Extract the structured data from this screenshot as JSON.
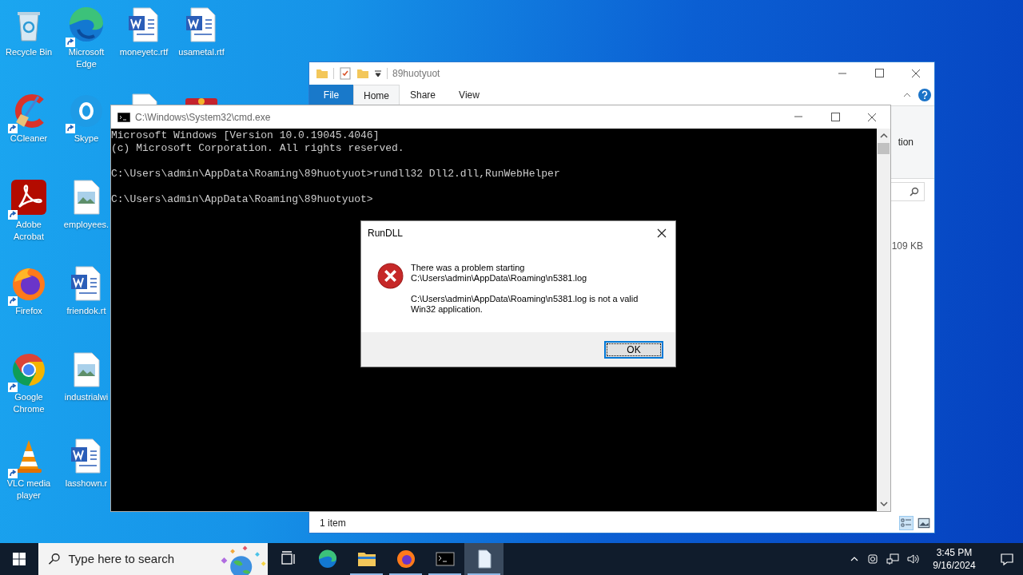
{
  "desktop_columns": [
    [
      {
        "label": "Recycle Bin",
        "kind": "recycle",
        "shortcut": false
      },
      {
        "label": "CCleaner",
        "kind": "broom",
        "shortcut": true
      },
      {
        "label": "Adobe Acrobat",
        "kind": "pdf",
        "shortcut": true
      },
      {
        "label": "Firefox",
        "kind": "firefox",
        "shortcut": true
      },
      {
        "label": "Google Chrome",
        "kind": "chrome",
        "shortcut": true
      },
      {
        "label": "VLC media player",
        "kind": "cone",
        "shortcut": true
      }
    ],
    [
      {
        "label": "Microsoft Edge",
        "kind": "edge",
        "shortcut": true
      },
      {
        "label": "Skype",
        "kind": "skype",
        "shortcut": true
      },
      {
        "label": "employees.",
        "kind": "image",
        "shortcut": false
      },
      {
        "label": "friendok.rt",
        "kind": "word",
        "shortcut": false
      },
      {
        "label": "industrialwi",
        "kind": "image",
        "shortcut": false
      },
      {
        "label": "lasshown.r",
        "kind": "word",
        "shortcut": false
      }
    ],
    [
      {
        "label": "moneyetc.rtf",
        "kind": "word",
        "shortcut": false
      },
      {
        "kind": "page"
      }
    ],
    [
      {
        "label": "usametal.rtf",
        "kind": "word",
        "shortcut": false
      },
      {
        "kind": "books"
      }
    ]
  ],
  "explorer": {
    "title": "89huotyuot",
    "tabs": [
      {
        "label": "File",
        "kind": "file",
        "selected": false
      },
      {
        "label": "Home",
        "kind": "tab",
        "selected": true
      },
      {
        "label": "Share",
        "kind": "tab",
        "selected": false
      },
      {
        "label": "View",
        "kind": "tab",
        "selected": false
      }
    ],
    "ribbon_fragment": "tion",
    "file_size": "109 KB",
    "status_bar": "1 item"
  },
  "cmd": {
    "title": "C:\\Windows\\System32\\cmd.exe",
    "blocks": [
      [
        "Microsoft Windows [Version 10.0.19045.4046]",
        "(c) Microsoft Corporation. All rights reserved."
      ],
      [
        "C:\\Users\\admin\\AppData\\Roaming\\89huotyuot>rundll32 Dll2.dll,RunWebHelper"
      ],
      [
        "C:\\Users\\admin\\AppData\\Roaming\\89huotyuot>"
      ]
    ]
  },
  "dialog": {
    "title": "RunDLL",
    "messages": [
      "There was a problem starting C:\\Users\\admin\\AppData\\Roaming\\n5381.log",
      "C:\\Users\\admin\\AppData\\Roaming\\n5381.log is not a valid Win32 application."
    ],
    "button": "OK"
  },
  "taskbar": {
    "search": {
      "placeholder": "Type here to search"
    },
    "apps": [
      {
        "kind": "taskview",
        "running": false,
        "active": false
      },
      {
        "kind": "edge",
        "running": false,
        "active": false
      },
      {
        "kind": "folder",
        "running": true,
        "active": false
      },
      {
        "kind": "firefox",
        "running": true,
        "active": false
      },
      {
        "kind": "terminal",
        "running": true,
        "active": false
      },
      {
        "kind": "page",
        "running": true,
        "active": true
      }
    ],
    "time": "3:45 PM",
    "date": "9/16/2024"
  }
}
